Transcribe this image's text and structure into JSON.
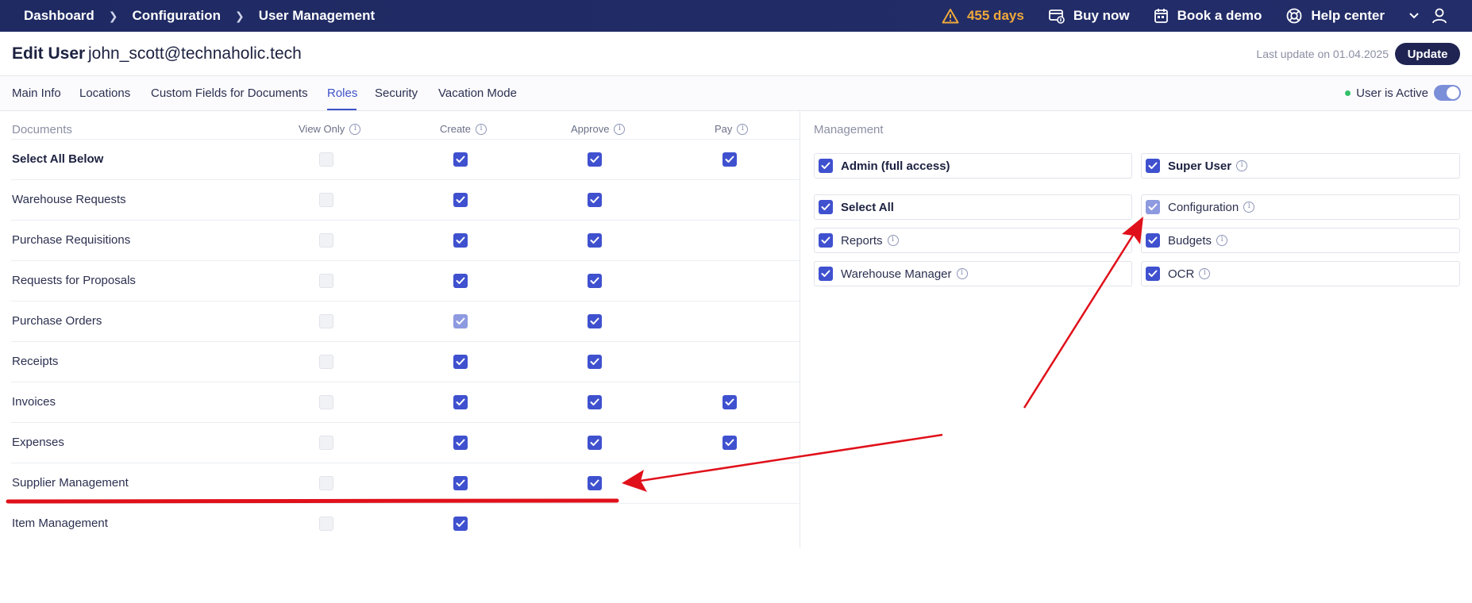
{
  "topbar": {
    "breadcrumbs": [
      "Dashboard",
      "Configuration",
      "User Management"
    ],
    "days_left": "455 days",
    "buy_now": "Buy now",
    "book_demo": "Book a demo",
    "help_center": "Help center"
  },
  "header": {
    "title": "Edit User",
    "email": "john_scott@technaholic.tech",
    "last_update": "Last update on 01.04.2025",
    "update_button": "Update"
  },
  "tabs": [
    "Main Info",
    "Locations",
    "Custom Fields for Documents",
    "Roles",
    "Security",
    "Vacation Mode"
  ],
  "active_tab": "Roles",
  "status": {
    "label": "User is Active",
    "active": true
  },
  "documents": {
    "title": "Documents",
    "columns": [
      "View Only",
      "Create",
      "Approve",
      "Pay"
    ],
    "rows": [
      {
        "label": "Select All Below",
        "bold": true,
        "view_only": "off",
        "create": "on",
        "approve": "on",
        "pay": "on"
      },
      {
        "label": "Warehouse Requests",
        "view_only": "off",
        "create": "on",
        "approve": "on",
        "pay": "none"
      },
      {
        "label": "Purchase Requisitions",
        "view_only": "off",
        "create": "on",
        "approve": "on",
        "pay": "none"
      },
      {
        "label": "Requests for Proposals",
        "view_only": "off",
        "create": "on",
        "approve": "on",
        "pay": "none"
      },
      {
        "label": "Purchase Orders",
        "view_only": "off",
        "create": "light",
        "approve": "on",
        "pay": "none"
      },
      {
        "label": "Receipts",
        "view_only": "off",
        "create": "on",
        "approve": "on",
        "pay": "none"
      },
      {
        "label": "Invoices",
        "view_only": "off",
        "create": "on",
        "approve": "on",
        "pay": "on"
      },
      {
        "label": "Expenses",
        "view_only": "off",
        "create": "on",
        "approve": "on",
        "pay": "on"
      },
      {
        "label": "Supplier Management",
        "view_only": "off",
        "create": "on",
        "approve": "on",
        "pay": "none"
      },
      {
        "label": "Item Management",
        "view_only": "off",
        "create": "on",
        "approve": "none",
        "pay": "none"
      }
    ]
  },
  "management": {
    "title": "Management",
    "items": [
      {
        "label": "Admin (full access)",
        "bold": true,
        "state": "on",
        "info": false
      },
      {
        "label": "Super User",
        "bold": true,
        "state": "on",
        "info": true
      },
      {
        "label": "Select All",
        "bold": true,
        "state": "on",
        "info": false
      },
      {
        "label": "Configuration",
        "bold": false,
        "state": "light",
        "info": true
      },
      {
        "label": "Reports",
        "bold": false,
        "state": "on",
        "info": true
      },
      {
        "label": "Budgets",
        "bold": false,
        "state": "on",
        "info": true
      },
      {
        "label": "Warehouse Manager",
        "bold": false,
        "state": "on",
        "info": true
      },
      {
        "label": "OCR",
        "bold": false,
        "state": "on",
        "info": true
      }
    ]
  },
  "colors": {
    "topbar": "#1f2a63",
    "accent": "#3f51cf",
    "days_warning": "#f0a93a",
    "annotation": "#e0101a"
  }
}
